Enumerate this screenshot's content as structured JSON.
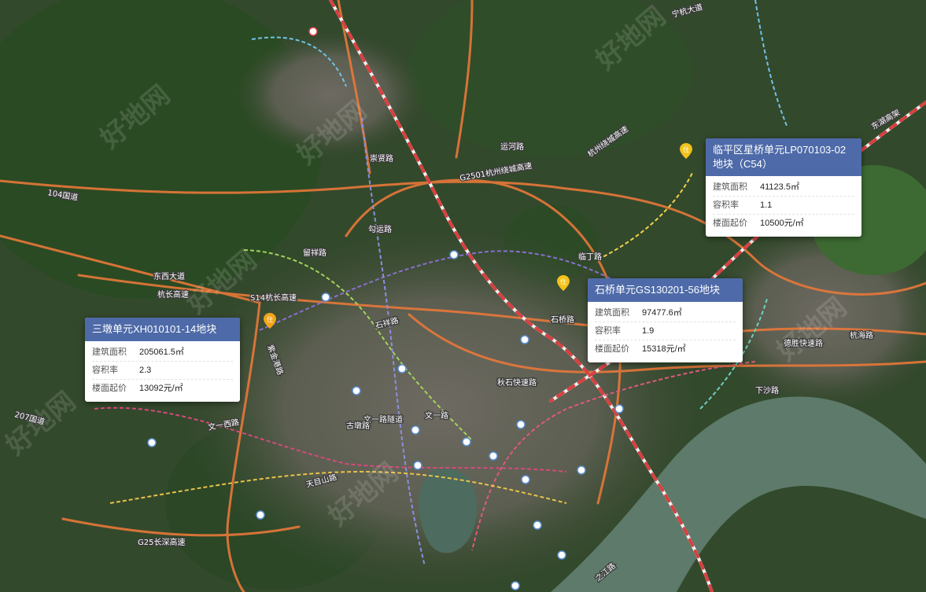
{
  "map": {
    "road_labels": [
      "104国道",
      "杭长高速",
      "东西大道",
      "S14杭长高速",
      "杭州绕城高速",
      "G2501杭州绕城高速",
      "G25长深高速",
      "宁杭大道",
      "崇贤路",
      "运河路",
      "勾运路",
      "文一路",
      "文一西路",
      "文一路隧道",
      "石祥路",
      "德胜快速路",
      "下沙路",
      "207国道",
      "留祥路",
      "秋石快速路",
      "东湖高架",
      "临丁路",
      "杭海路",
      "紫金港路",
      "古墩路",
      "石桥路",
      "天目山路",
      "之江路"
    ],
    "watermarks": [
      "好地网",
      "好地网",
      "好地网",
      "好地网",
      "好地网",
      "好地网",
      "好地网"
    ],
    "metro_station_icon": "metro-station-icon"
  },
  "cards": [
    {
      "title": "三墩单元XH010101-14地块",
      "rows": [
        {
          "label": "建筑面积",
          "value": "205061.5㎡"
        },
        {
          "label": "容积率",
          "value": "2.3"
        },
        {
          "label": "楼面起价",
          "value": "13092元/㎡"
        }
      ]
    },
    {
      "title": "临平区星桥单元LP070103-02 地块（C54）",
      "rows": [
        {
          "label": "建筑面积",
          "value": "41123.5㎡"
        },
        {
          "label": "容积率",
          "value": "1.1"
        },
        {
          "label": "楼面起价",
          "value": "10500元/㎡"
        }
      ]
    },
    {
      "title": "石桥单元GS130201-56地块",
      "rows": [
        {
          "label": "建筑面积",
          "value": "97477.6㎡"
        },
        {
          "label": "容积率",
          "value": "1.9"
        },
        {
          "label": "楼面起价",
          "value": "15318元/㎡"
        }
      ]
    }
  ],
  "pins": [
    {
      "label": "住",
      "color": "#f2a51a"
    },
    {
      "label": "住",
      "color": "#f2c21a"
    },
    {
      "label": "住",
      "color": "#f2c21a"
    }
  ],
  "colors": {
    "card_header": "#4e6aa8",
    "highway": "#e8783a",
    "railway": "#d9d9d9",
    "river": "#5d7a6a"
  }
}
